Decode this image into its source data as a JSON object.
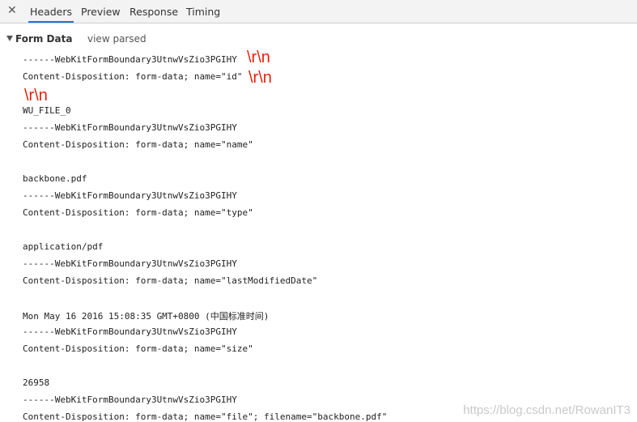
{
  "tabs": {
    "close_glyph": "✕",
    "items": [
      "Headers",
      "Preview",
      "Response",
      "Timing"
    ],
    "active": "Headers",
    "accent_color": "#1a73e8"
  },
  "section": {
    "title": "Form Data",
    "toggle": "view parsed"
  },
  "body_lines": [
    "------WebKitFormBoundary3UtnwVsZio3PGIHY",
    "Content-Disposition: form-data; name=\"id\"",
    "WU_FILE_0",
    "------WebKitFormBoundary3UtnwVsZio3PGIHY",
    "Content-Disposition: form-data; name=\"name\"",
    "backbone.pdf",
    "------WebKitFormBoundary3UtnwVsZio3PGIHY",
    "Content-Disposition: form-data; name=\"type\"",
    "application/pdf",
    "------WebKitFormBoundary3UtnwVsZio3PGIHY",
    "Content-Disposition: form-data; name=\"lastModifiedDate\"",
    "Mon May 16 2016 15:08:35 GMT+0800 (中国标准时间)",
    "------WebKitFormBoundary3UtnwVsZio3PGIHY",
    "Content-Disposition: form-data; name=\"size\"",
    "26958",
    "------WebKitFormBoundary3UtnwVsZio3PGIHY",
    "Content-Disposition: form-data; name=\"file\"; filename=\"backbone.pdf\""
  ],
  "annotations": [
    "\\r\\n",
    "\\r\\n",
    "\\r\\n"
  ],
  "annotation_color": "#e8220d",
  "watermark": "https://blog.csdn.net/RowanIT3"
}
